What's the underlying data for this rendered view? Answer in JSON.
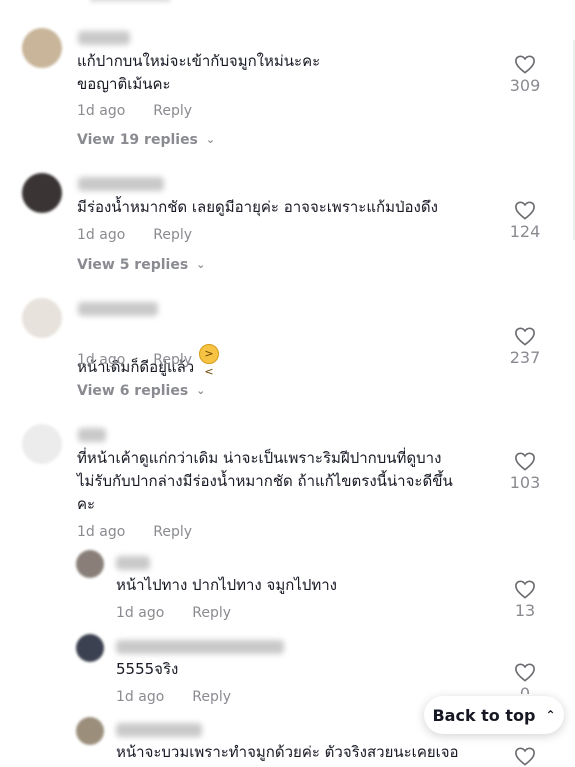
{
  "comments": [
    {
      "text": "แก้ปากบนใหม่จะเข้ากับจมูกใหม่นะคะ\nขอญาติเม้นคะ",
      "time": "1d ago",
      "reply_label": "Reply",
      "likes": "309",
      "view_replies": "View 19 replies"
    },
    {
      "text": "มีร่องน้ำหมากชัด เลยดูมีอายุค่ะ อาจจะเพราะแก้มป่องดึง",
      "time": "1d ago",
      "reply_label": "Reply",
      "likes": "124",
      "view_replies": "View 5 replies"
    },
    {
      "text": "หน้าเดิมก็ดีอยู่แล้ว",
      "time": "1d ago",
      "reply_label": "Reply",
      "likes": "237",
      "view_replies": "View 6 replies"
    },
    {
      "text": "ที่หน้าเค้าดูแก่กว่าเดิม น่าจะเป็นเพราะริมฝีปากบนที่ดูบาง\nไม่รับกับปากล่างมีร่องน้ำหมากชัด ถ้าแก้ไขตรงนี้น่าจะดีขึ้น\nคะ",
      "time": "1d ago",
      "reply_label": "Reply",
      "likes": "103"
    }
  ],
  "replies": [
    {
      "text": "หน้าไปทาง ปากไปทาง จมูกไปทาง",
      "time": "1d ago",
      "reply_label": "Reply",
      "likes": "13"
    },
    {
      "text": "5555จริง",
      "time": "1d ago",
      "reply_label": "Reply",
      "likes": "0"
    },
    {
      "text": "หน้าจะบวมเพราะทำจมูกด้วยค่ะ ตัวจริงสวยนะเคยเจอ"
    }
  ],
  "back_to_top": "Back to top",
  "icons": {
    "like": "heart-outline-icon",
    "expand": "chevron-down-icon",
    "back": "double-chevron-up-icon"
  }
}
